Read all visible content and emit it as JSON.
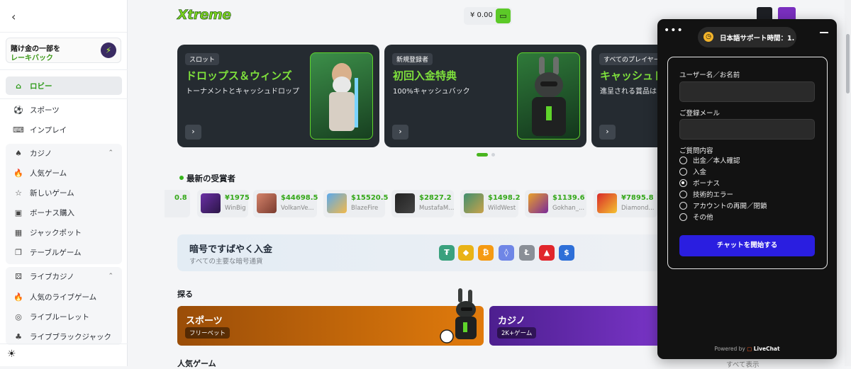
{
  "sidebar": {
    "back_icon": "chevron-left-icon",
    "cashback_line1": "賭け金の一部を",
    "cashback_line2": "レーキバック",
    "items": [
      {
        "label": "ロビー",
        "icon": "home-icon"
      },
      {
        "label": "スポーツ",
        "icon": "soccer-ball-icon"
      },
      {
        "label": "インプレイ",
        "icon": "gamepad-icon"
      },
      {
        "label": "カジノ",
        "icon": "spade-icon"
      },
      {
        "label": "人気ゲーム",
        "icon": "fire-icon"
      },
      {
        "label": "新しいゲーム",
        "icon": "star-icon"
      },
      {
        "label": "ボーナス購入",
        "icon": "ticket-icon"
      },
      {
        "label": "ジャックポット",
        "icon": "slot-icon"
      },
      {
        "label": "テーブルゲーム",
        "icon": "cards-icon"
      },
      {
        "label": "ライブカジノ",
        "icon": "dice-icon"
      },
      {
        "label": "人気のライブゲーム",
        "icon": "fire-icon"
      },
      {
        "label": "ライブルーレット",
        "icon": "roulette-icon"
      },
      {
        "label": "ライブブラックジャック",
        "icon": "club-icon"
      }
    ],
    "theme_icon": "sun-icon"
  },
  "header": {
    "logo": "Xtreme",
    "balance": "¥ 0.00",
    "wallet_icon": "wallet-icon"
  },
  "promos": [
    {
      "tag": "スロット",
      "title": "ドロップス＆ウィンズ",
      "subtitle": "トーナメントとキャッシュドロップ"
    },
    {
      "tag": "新規登録者",
      "title": "初回入金特典",
      "subtitle": "100%キャッシュバック"
    },
    {
      "tag": "すべてのプレイヤー",
      "title": "キャッシュド",
      "subtitle": "進呈される賞品は"
    }
  ],
  "winners": {
    "title": "最新の受賞者",
    "items": [
      {
        "amount": "0.8",
        "game": ""
      },
      {
        "amount": "¥1975",
        "game": "WinBig"
      },
      {
        "amount": "$44698.5",
        "game": "VolkanVe..."
      },
      {
        "amount": "$15520.5",
        "game": "BlazeFire"
      },
      {
        "amount": "$2827.2",
        "game": "MustafaM..."
      },
      {
        "amount": "$1498.2",
        "game": "WildWest"
      },
      {
        "amount": "$1139.6",
        "game": "Gokhan_..."
      },
      {
        "amount": "¥7895.8",
        "game": "Diamond..."
      }
    ]
  },
  "crypto": {
    "title": "暗号ですばやく入金",
    "subtitle": "すべての主要な暗号通貨",
    "coins": [
      {
        "symbol": "₮",
        "color": "#3aa17e"
      },
      {
        "symbol": "◆",
        "color": "#e9b317"
      },
      {
        "symbol": "₿",
        "color": "#f59a12"
      },
      {
        "symbol": "◊",
        "color": "#6f86e6"
      },
      {
        "symbol": "Ł",
        "color": "#8a8f97"
      },
      {
        "symbol": "▲",
        "color": "#e1262c"
      },
      {
        "symbol": "$",
        "color": "#2e6fd8"
      }
    ]
  },
  "explore": {
    "title": "探る",
    "categories": [
      {
        "name": "スポーツ",
        "badge": "フリーベット"
      },
      {
        "name": "カジノ",
        "badge": "2K+ゲーム"
      }
    ]
  },
  "popular": {
    "title": "人気ゲーム",
    "show_all": "すべて表示"
  },
  "chat": {
    "menu_icon": "more-horizontal-icon",
    "support_hours": "日本語サポート時間：1...",
    "minimize_icon": "minimize-icon",
    "name_label": "ユーザー名／お名前",
    "email_label": "ご登録メール",
    "question_label": "ご質問内容",
    "options": [
      {
        "label": "出金／本人確認",
        "selected": false
      },
      {
        "label": "入金",
        "selected": false
      },
      {
        "label": "ボーナス",
        "selected": true
      },
      {
        "label": "技術的エラー",
        "selected": false
      },
      {
        "label": "アカウントの再開／閉鎖",
        "selected": false
      },
      {
        "label": "その他",
        "selected": false
      }
    ],
    "start_button": "チャットを開始する",
    "powered_by": "Powered by",
    "brand": "LiveChat"
  }
}
